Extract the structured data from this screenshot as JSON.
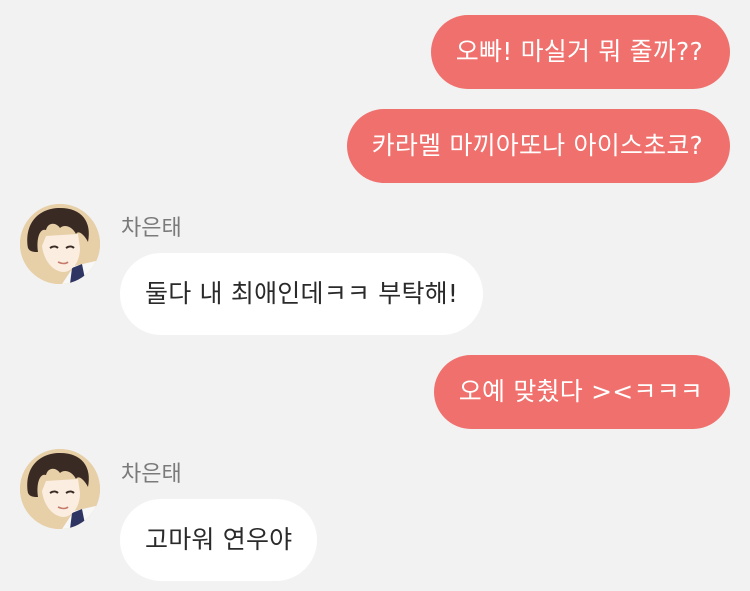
{
  "messages": [
    {
      "direction": "outgoing",
      "text": "오빠! 마실거 뭐 줄까??"
    },
    {
      "direction": "outgoing",
      "text": "카라멜 마끼아또나 아이스초코?"
    },
    {
      "direction": "incoming",
      "sender": "차은태",
      "text": "둘다 내 최애인데ㅋㅋ 부탁해!"
    },
    {
      "direction": "outgoing",
      "text": "오예 맞췄다 ><ㅋㅋㅋ"
    },
    {
      "direction": "incoming",
      "sender": "차은태",
      "text": "고마워 연우야"
    }
  ],
  "colors": {
    "background": "#f2f2f2",
    "outgoing_bubble": "#ef706c",
    "outgoing_text": "#ffffff",
    "incoming_bubble": "#ffffff",
    "incoming_text": "#2a2a2a",
    "sender_name": "#7a7a7a"
  },
  "icons": {
    "avatar": "avatar-illustration"
  }
}
